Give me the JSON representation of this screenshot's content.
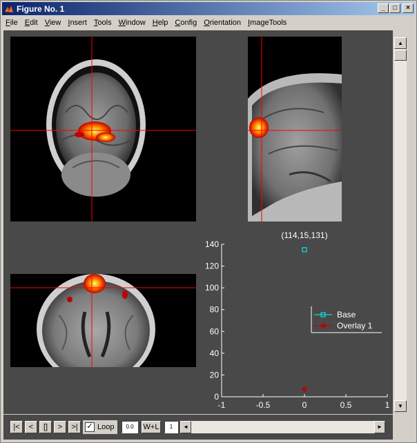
{
  "window": {
    "title": "Figure No. 1",
    "buttons": {
      "minimize": "_",
      "maximize": "□",
      "close": "×"
    }
  },
  "menu": [
    "File",
    "Edit",
    "View",
    "Insert",
    "Tools",
    "Window",
    "Help",
    "Config",
    "Orientation",
    "ImageTools"
  ],
  "plot": {
    "coord_label": "(114,15,131)",
    "y_ticks": [
      "140",
      "120",
      "100",
      "80",
      "60",
      "40",
      "20",
      "0"
    ],
    "x_ticks": [
      "-1",
      "-0.5",
      "0",
      "0.5",
      "1"
    ],
    "legend": [
      {
        "label": "Base",
        "color": "#00ffff",
        "marker": "square"
      },
      {
        "label": "Overlay 1",
        "color": "#c00000",
        "marker": "star"
      }
    ]
  },
  "chart_data": {
    "type": "scatter",
    "xlim": [
      -1,
      1
    ],
    "ylim": [
      0,
      140
    ],
    "series": [
      {
        "name": "Base",
        "x": [
          0
        ],
        "y": [
          135
        ],
        "color": "#00ffff"
      },
      {
        "name": "Overlay 1",
        "x": [
          0
        ],
        "y": [
          7
        ],
        "color": "#c00000"
      }
    ],
    "legend": "right",
    "grid": false
  },
  "controls": {
    "first": "|<",
    "prev": "<",
    "stop": "[]",
    "next": ">",
    "last": ">|",
    "loop_label": "Loop",
    "loop_checked": "✓",
    "speed_value": "0.0",
    "wl_label": "W+L",
    "frame_value": "1",
    "hscroll_left": "◄",
    "hscroll_right": "►",
    "vscroll_up": "▲",
    "vscroll_down": "▼"
  },
  "colors": {
    "background": "#494949",
    "crosshair": "#ff0000",
    "base": "#00ffff",
    "overlay": "#c00000"
  }
}
